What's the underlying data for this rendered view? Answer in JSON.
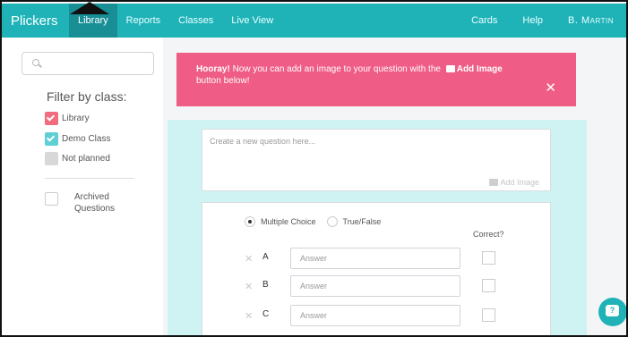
{
  "topbar": {
    "brand": "Plickers",
    "nav": [
      {
        "label": "Library",
        "active": true
      },
      {
        "label": "Reports",
        "active": false
      },
      {
        "label": "Classes",
        "active": false
      },
      {
        "label": "Live View",
        "active": false
      }
    ],
    "right": [
      "Cards",
      "Help"
    ],
    "user": "B. Martin",
    "accent": "#1fb3b8"
  },
  "sidebar": {
    "filter_title": "Filter by class:",
    "classes": [
      {
        "label": "Library",
        "checked": true,
        "color": "#f06c7e"
      },
      {
        "label": "Demo Class",
        "checked": true,
        "color": "#5ecfd4"
      },
      {
        "label": "Not planned",
        "checked": false,
        "color": "#d8d8d8"
      }
    ],
    "archived_label": "Archived Questions"
  },
  "banner": {
    "bold": "Hooray!",
    "text": " Now you can add an image to your question with the ",
    "add_image": "Add Image",
    "text2": "button below!",
    "color": "#ef5c85"
  },
  "editor": {
    "question_placeholder": "Create a new question here...",
    "add_image": "Add Image",
    "types": {
      "multiple": "Multiple Choice",
      "tf": "True/False",
      "selected": "Multiple Choice"
    },
    "correct_header": "Correct?",
    "answers": [
      {
        "letter": "A",
        "placeholder": "Answer"
      },
      {
        "letter": "B",
        "placeholder": "Answer"
      },
      {
        "letter": "C",
        "placeholder": "Answer"
      }
    ]
  }
}
